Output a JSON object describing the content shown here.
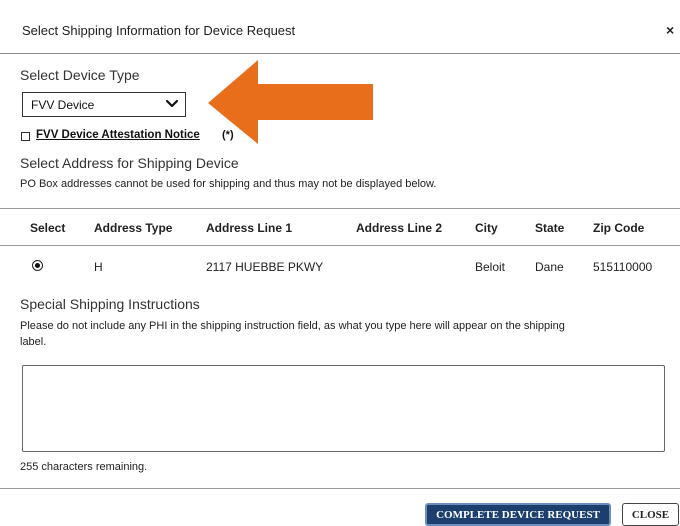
{
  "dialog": {
    "title": "Select Shipping Information for Device Request",
    "close_symbol": "×"
  },
  "device": {
    "section_label": "Select Device Type",
    "selected_value": "FVV Device",
    "attestation_label": "FVV Device Attestation Notice",
    "attestation_required": "(*)",
    "attestation_checked": false
  },
  "address": {
    "section_label": "Select Address for Shipping Device",
    "note": "PO Box addresses cannot be used for shipping and thus may not be displayed below.",
    "columns": [
      "Select",
      "Address Type",
      "Address Line 1",
      "Address Line 2",
      "City",
      "State",
      "Zip Code"
    ],
    "rows": [
      {
        "selected": true,
        "address_type": "H",
        "address_line_1": "2117 HUEBBE PKWY",
        "address_line_2": "",
        "city": "Beloit",
        "state": "Dane",
        "zip_code": "515110000"
      }
    ]
  },
  "instructions": {
    "section_label": "Special Shipping Instructions",
    "warning": "Please do not include any PHI in the shipping instruction field, as what you type here will appear on the shipping",
    "warning_cont": "label.",
    "value": "",
    "remaining": "255 characters remaining."
  },
  "footer": {
    "complete_label": "COMPLETE DEVICE REQUEST",
    "close_label": "CLOSE"
  },
  "colors": {
    "arrow": "#e86e1c",
    "primary_button": "#1c3f6e",
    "primary_border": "#6d8fbf"
  },
  "icons": {
    "dropdown": "chevron-down-icon",
    "callout": "arrow-left-icon",
    "close": "close-icon"
  }
}
